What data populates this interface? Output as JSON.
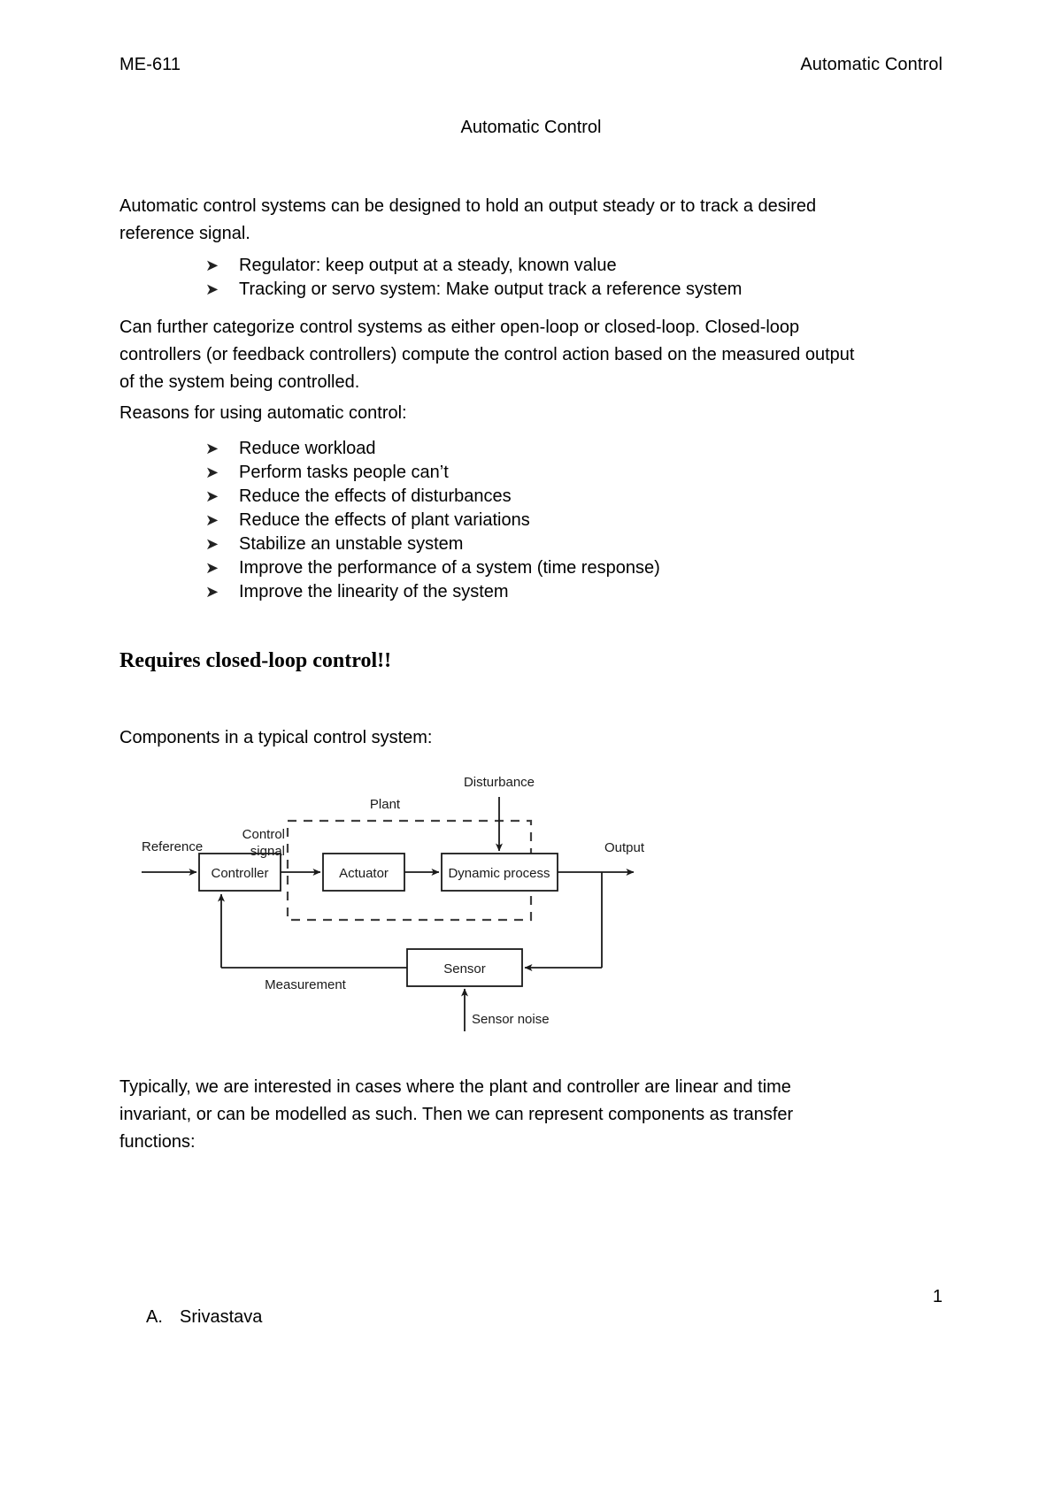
{
  "header": {
    "course_code": "ME-611",
    "course_name": "Automatic Control"
  },
  "document": {
    "title": "Automatic Control",
    "intro_paragraph": "Automatic control systems can be designed to hold an output steady or to track a desired reference signal.",
    "categorize_paragraph": " Can further categorize control systems as either open-loop or closed-loop. Closed-loop controllers (or feedback controllers) compute the control action based on the measured output of the system being controlled.",
    "reasons_heading": "Reasons for using automatic control:",
    "section_heading": "Requires closed-loop control!!",
    "components_heading": "Components in a typical control system:",
    "typically_paragraph": "Typically, we are interested in cases where the plant and controller are linear and time invariant, or can be modelled as such. Then we can represent components as transfer functions:"
  },
  "bullet_glyph": "➤",
  "control_modes": [
    "Regulator: keep output at a steady, known value",
    "Tracking or servo system: Make output track a reference system"
  ],
  "reasons_list": [
    "Reduce workload",
    "Perform tasks people can’t",
    "Reduce the effects of disturbances",
    "Reduce the effects of plant variations",
    "Stabilize an unstable system",
    "Improve the performance of a system (time response)",
    "Improve the linearity of the system"
  ],
  "diagram": {
    "blocks": {
      "controller": "Controller",
      "actuator": "Actuator",
      "dynamic_process": "Dynamic process",
      "sensor": "Sensor"
    },
    "labels": {
      "reference": "Reference",
      "control_signal_line1": "Control",
      "control_signal_line2": "signal",
      "plant": "Plant",
      "disturbance": "Disturbance",
      "output": "Output",
      "measurement": "Measurement",
      "sensor_noise": "Sensor noise"
    },
    "colors": {
      "line": "#1a1a1a",
      "dashed_boundary": "#404040",
      "text": "#1a1a1a"
    }
  },
  "footer": {
    "page_number": "1",
    "author_marker": "A.",
    "author_name": "Srivastava"
  }
}
